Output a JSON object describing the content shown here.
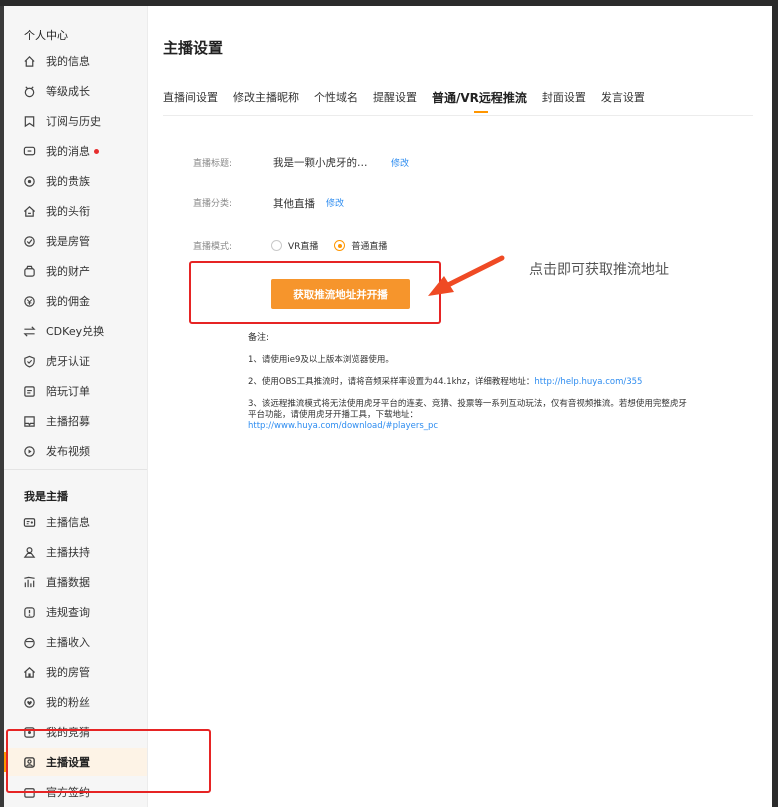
{
  "sidebar": {
    "section1": "个人中心",
    "items1": [
      {
        "label": "我的信息",
        "icon": "home-icon"
      },
      {
        "label": "等级成长",
        "icon": "growth-icon"
      },
      {
        "label": "订阅与历史",
        "icon": "bookmark-icon"
      },
      {
        "label": "我的消息",
        "icon": "message-icon",
        "dot": true
      },
      {
        "label": "我的贵族",
        "icon": "noble-icon"
      },
      {
        "label": "我的头衔",
        "icon": "title-icon"
      },
      {
        "label": "我是房管",
        "icon": "check-circle-icon"
      },
      {
        "label": "我的财产",
        "icon": "wallet-icon"
      },
      {
        "label": "我的佣金",
        "icon": "commission-icon"
      },
      {
        "label": "CDKey兑换",
        "icon": "exchange-icon"
      },
      {
        "label": "虎牙认证",
        "icon": "shield-icon"
      },
      {
        "label": "陪玩订单",
        "icon": "order-icon"
      },
      {
        "label": "主播招募",
        "icon": "recruit-icon"
      },
      {
        "label": "发布视频",
        "icon": "play-icon"
      }
    ],
    "section2": "我是主播",
    "items2": [
      {
        "label": "主播信息",
        "icon": "id-card-icon"
      },
      {
        "label": "主播扶持",
        "icon": "support-icon"
      },
      {
        "label": "直播数据",
        "icon": "chart-icon"
      },
      {
        "label": "违规查询",
        "icon": "alert-icon"
      },
      {
        "label": "主播收入",
        "icon": "income-icon"
      },
      {
        "label": "我的房管",
        "icon": "house-icon"
      },
      {
        "label": "我的粉丝",
        "icon": "fans-icon"
      },
      {
        "label": "我的竞猜",
        "icon": "guess-icon"
      },
      {
        "label": "主播设置",
        "icon": "settings-icon",
        "active": true
      },
      {
        "label": "官方签约",
        "icon": "sign-icon"
      }
    ]
  },
  "main": {
    "title": "主播设置",
    "tabs": [
      "直播间设置",
      "修改主播昵称",
      "个性域名",
      "提醒设置",
      "普通/VR远程推流",
      "封面设置",
      "发言设置"
    ],
    "active_tab": 4,
    "form": {
      "title_label": "直播标题:",
      "title_value": "我是一颗小虎牙的…",
      "title_edit": "修改",
      "category_label": "直播分类:",
      "category_value": "其他直播",
      "category_edit": "修改",
      "mode_label": "直播模式:",
      "mode_vr": "VR直播",
      "mode_normal": "普通直播",
      "mode_selected": "普通直播"
    },
    "cta_button": "获取推流地址并开播",
    "annotation": "点击即可获取推流地址",
    "notes": {
      "title": "备注:",
      "n1": "1、请使用ie9及以上版本浏览器使用。",
      "n2_text": "2、使用OBS工具推流时，请将音频采样率设置为44.1khz，详细教程地址：",
      "n2_link": "http://help.huya.com/355",
      "n3_text": "3、该远程推流模式将无法使用虎牙平台的连麦、竞猜、投票等一系列互动玩法，仅有音视频推流。若想使用完整虎牙平台功能，请使用虎牙开播工具，下载地址：",
      "n3_link": "http://www.huya.com/download/#players_pc"
    }
  },
  "colors": {
    "accent": "#ff9600",
    "button": "#f6952c",
    "link": "#2d8cf0",
    "highlight": "#e62424"
  }
}
